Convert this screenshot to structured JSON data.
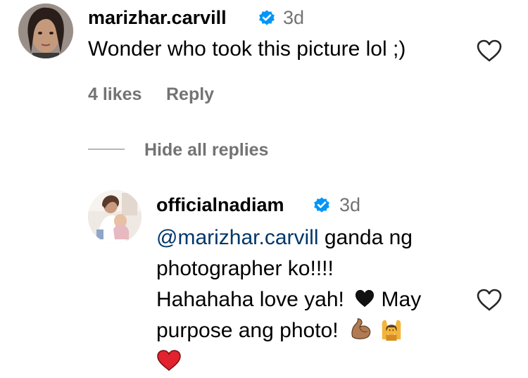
{
  "comment": {
    "username": "marizhar.carvill",
    "time": "3d",
    "text": "Wonder who took this picture lol ;)",
    "likes": "4 likes",
    "reply": "Reply"
  },
  "replies_toggle": "Hide all replies",
  "reply": {
    "username": "officialnadiam",
    "time": "3d",
    "mention": "@marizhar.carvill",
    "line1_rest": " ganda ng",
    "line2": "photographer ko!!!!",
    "line3": "Hahahaha love yah!",
    "line3_after": " May",
    "line4": "purpose ang photo!"
  },
  "icons": {
    "verified": "verified-badge-icon",
    "heart": "heart-outline-icon",
    "black_heart": "black-heart-emoji",
    "muscle": "flexed-biceps-emoji",
    "raised_hands": "person-raising-hands-emoji",
    "red_heart": "red-heart-emoji"
  },
  "colors": {
    "verified": "#0095f6",
    "secondary_text": "#737373",
    "mention": "#00376b"
  }
}
